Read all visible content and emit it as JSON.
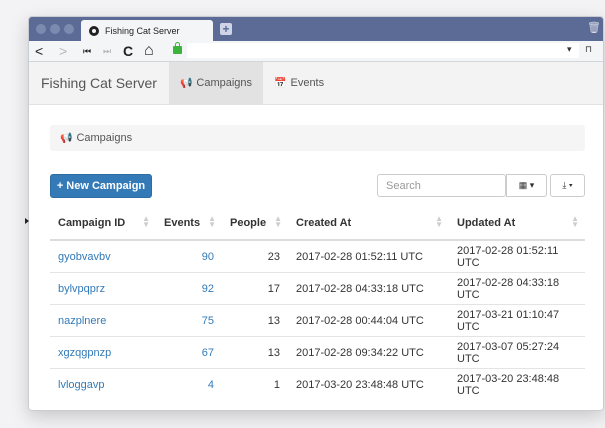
{
  "browser": {
    "tab_title": "Fishing Cat Server",
    "new_tab_glyph": "+",
    "trash_glyph": "🗑",
    "nav": {
      "back": "<",
      "forward": ">",
      "first": "⏮",
      "last": "⏭",
      "reload": "C",
      "home": "⌂"
    },
    "toolbar_right": {
      "dropdown": "▾",
      "bookmark": "⊓"
    }
  },
  "navbar": {
    "brand": "Fishing Cat Server",
    "links": [
      {
        "label": "Campaigns",
        "icon": "megaphone-icon",
        "glyph": "📢",
        "active": true
      },
      {
        "label": "Events",
        "icon": "calendar-icon",
        "glyph": "📅",
        "active": false
      }
    ]
  },
  "breadcrumb": {
    "label": "Campaigns",
    "icon": "megaphone-icon",
    "glyph": "📢"
  },
  "toolbar": {
    "new_campaign_label": "+ New Campaign",
    "search_placeholder": "Search",
    "columns_button": "▦ ▾",
    "export_button": "⤓ ▾"
  },
  "table": {
    "headers": [
      "Campaign ID",
      "Events",
      "People",
      "Created At",
      "Updated At"
    ],
    "rows": [
      {
        "id": "gyobvavbv",
        "events": "90",
        "people": "23",
        "created": "2017-02-28 01:52:11 UTC",
        "updated": "2017-02-28 01:52:11 UTC"
      },
      {
        "id": "bylvpqprz",
        "events": "92",
        "people": "17",
        "created": "2017-02-28 04:33:18 UTC",
        "updated": "2017-02-28 04:33:18 UTC"
      },
      {
        "id": "nazplnere",
        "events": "75",
        "people": "13",
        "created": "2017-02-28 00:44:04 UTC",
        "updated": "2017-03-21 01:10:47 UTC"
      },
      {
        "id": "xgzqgpnzp",
        "events": "67",
        "people": "13",
        "created": "2017-02-28 09:34:22 UTC",
        "updated": "2017-03-07 05:27:24 UTC"
      },
      {
        "id": "lvloggavp",
        "events": "4",
        "people": "1",
        "created": "2017-03-20 23:48:48 UTC",
        "updated": "2017-03-20 23:48:48 UTC"
      }
    ]
  },
  "colors": {
    "primary": "#337ab7",
    "tabbar": "#5b6b95",
    "lock": "#3cb43c"
  }
}
